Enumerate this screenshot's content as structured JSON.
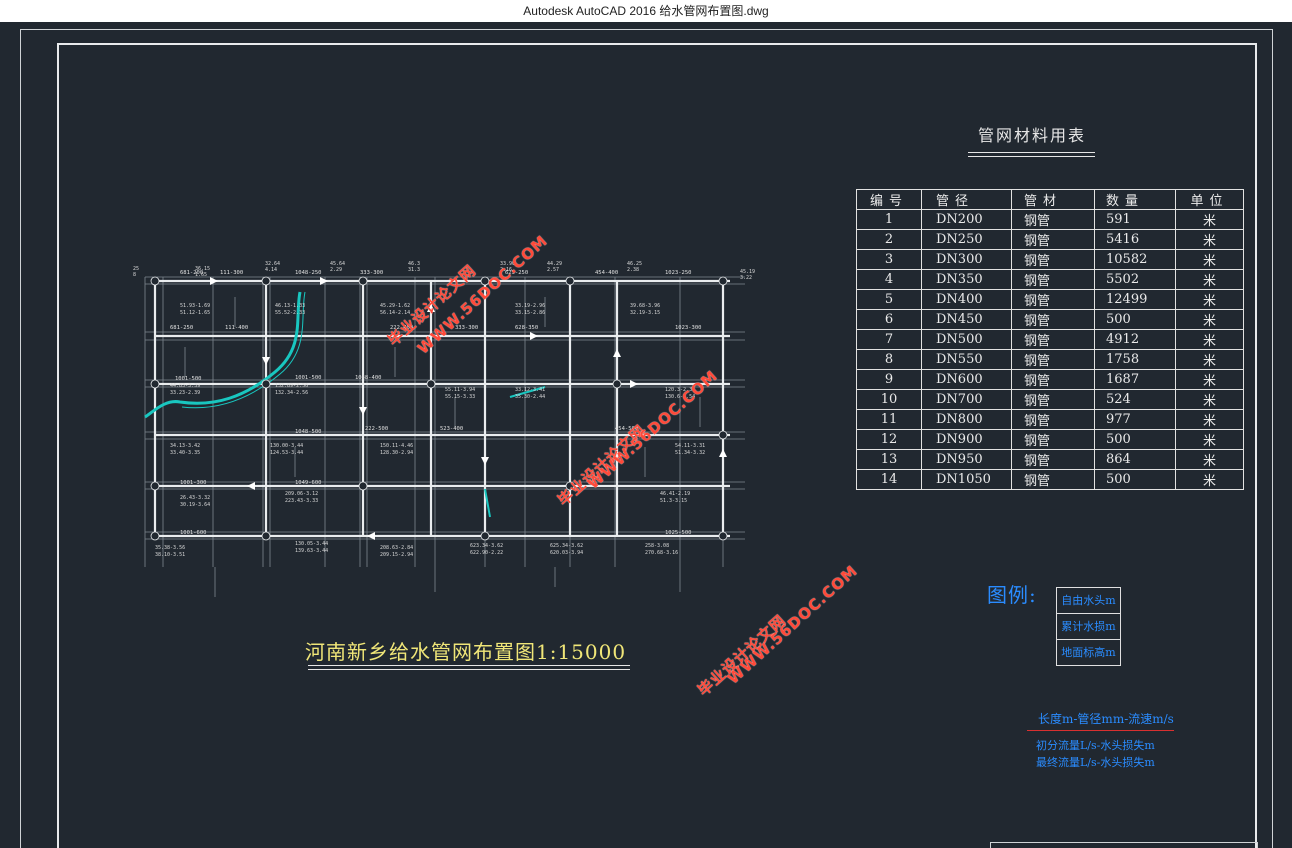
{
  "window": {
    "title": "Autodesk AutoCAD 2016    给水管网布置图.dwg"
  },
  "material_table": {
    "title": "管网材料用表",
    "headers": [
      "编号",
      "管径",
      "管材",
      "数量",
      "单位"
    ],
    "rows": [
      [
        "1",
        "DN200",
        "钢管",
        "591",
        "米"
      ],
      [
        "2",
        "DN250",
        "钢管",
        "5416",
        "米"
      ],
      [
        "3",
        "DN300",
        "钢管",
        "10582",
        "米"
      ],
      [
        "4",
        "DN350",
        "钢管",
        "5502",
        "米"
      ],
      [
        "5",
        "DN400",
        "钢管",
        "12499",
        "米"
      ],
      [
        "6",
        "DN450",
        "钢管",
        "500",
        "米"
      ],
      [
        "7",
        "DN500",
        "钢管",
        "4912",
        "米"
      ],
      [
        "8",
        "DN550",
        "钢管",
        "1758",
        "米"
      ],
      [
        "9",
        "DN600",
        "钢管",
        "1687",
        "米"
      ],
      [
        "10",
        "DN700",
        "钢管",
        "524",
        "米"
      ],
      [
        "11",
        "DN800",
        "钢管",
        "977",
        "米"
      ],
      [
        "12",
        "DN900",
        "钢管",
        "500",
        "米"
      ],
      [
        "13",
        "DN950",
        "钢管",
        "864",
        "米"
      ],
      [
        "14",
        "DN1050",
        "钢管",
        "500",
        "米"
      ]
    ]
  },
  "legend": {
    "label": "图例:",
    "items": [
      "自由水头m",
      "累计水损m",
      "地面标高m"
    ],
    "pipe_key": "长度m-管径mm-流速m/s",
    "flow_key_1": "初分流量L/s-水头损失m",
    "flow_key_2": "最终流量L/s-水头损失m"
  },
  "map": {
    "title": "河南新乡给水管网布置图1:15000",
    "pipe_labels": [
      "681-200",
      "111-300",
      "1048-250",
      "333-300",
      "625-250",
      "454-400",
      "1023-250",
      "681-250",
      "111-400",
      "1001-500",
      "1048-400",
      "222-400",
      "333-300",
      "628-350",
      "1023-300",
      "1001-500",
      "1048-500",
      "222-500",
      "523-400",
      "454-500",
      "1001-300",
      "1049-600",
      "1001-600",
      "1025-500"
    ]
  },
  "watermarks": [
    "毕业设计论文网",
    "WWW.56DOC.COM"
  ],
  "colors": {
    "background": "#212830",
    "accent_blue": "#2a8cff",
    "title_yellow": "#f0e678",
    "river": "#19c7c0",
    "watermark": "#ff4a3a"
  }
}
